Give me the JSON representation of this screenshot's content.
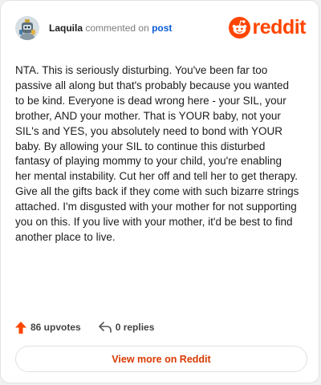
{
  "header": {
    "username": "Laquila",
    "commented_on": "commented on",
    "post_link": "post",
    "logo_word": "reddit",
    "logo_icon": "reddit-snoo-icon",
    "avatar_icon": "user-avatar"
  },
  "comment": {
    "text": "NTA. This is seriously disturbing. You've been far too passive all along but that's probably because you wanted to be kind. Everyone is dead wrong here - your SIL, your brother, AND your mother. That is YOUR baby, not your SIL's and YES, you absolutely need to bond with YOUR baby. By allowing your SIL to continue this disturbed fantasy of playing mommy to your child, you're enabling her mental instability. Cut her off and tell her to get therapy. Give all the gifts back if they come with such bizarre strings attached. I'm disgusted with your mother for not supporting you on this. If you live with your mother, it'd be best to find another place to live."
  },
  "actions": {
    "upvotes": "86 upvotes",
    "upvote_icon": "upvote-arrow-icon",
    "replies": "0 replies",
    "reply_icon": "reply-arrow-icon"
  },
  "footer": {
    "view_more": "View more on Reddit"
  },
  "colors": {
    "brand": "#ff4500",
    "link": "#0a5bd6",
    "view_more_text": "#d93a00"
  }
}
